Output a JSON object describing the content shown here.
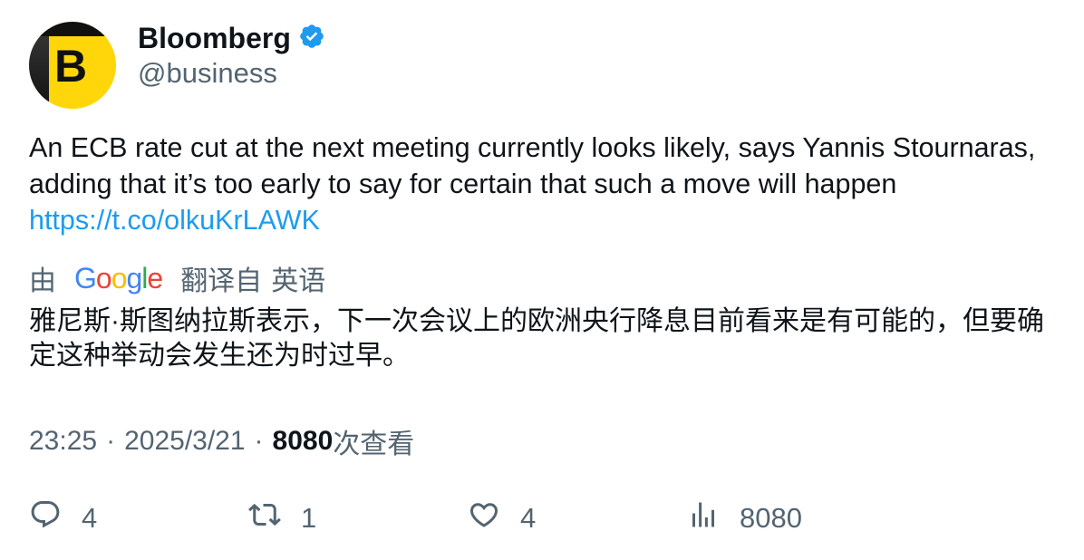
{
  "author": {
    "avatar_letter": "B",
    "display_name": "Bloomberg",
    "handle": "@business",
    "verified_icon": "verified-badge-icon"
  },
  "tweet": {
    "text": "An ECB rate cut at the next meeting currently looks likely, says Yannis Stournaras, adding that it’s too early to say for certain that such a move will happen",
    "link": "https://t.co/olkuKrLAWK"
  },
  "translation": {
    "prefix": "由",
    "logo": "Google",
    "translated_from": "翻译自",
    "language": "英语",
    "text": "雅尼斯·斯图纳拉斯表示，下一次会议上的欧洲央行降息目前看来是有可能的，但要确定这种举动会发生还为时过早。"
  },
  "meta": {
    "time": "23:25",
    "date": "2025/3/21",
    "separator": "·",
    "views_count": "8080",
    "views_label": "次查看"
  },
  "actions": {
    "replies": "4",
    "retweets": "1",
    "likes": "4",
    "views": "8080"
  },
  "colors": {
    "link": "#1d9bf0",
    "secondary_text": "#536471",
    "verified": "#1d9bf0",
    "avatar_bg": "#ffd60a"
  }
}
